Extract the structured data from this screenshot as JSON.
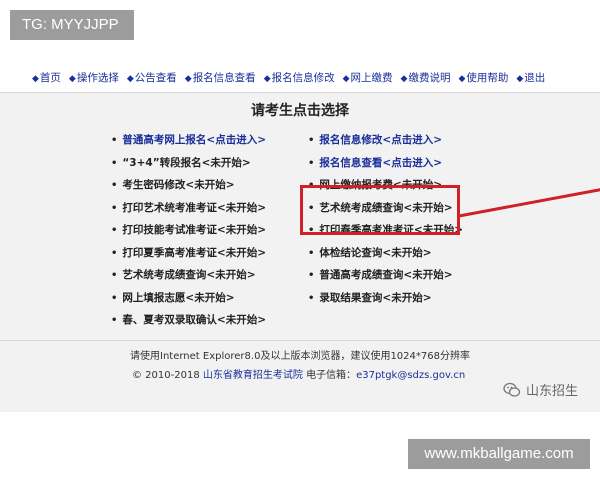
{
  "overlay": {
    "top_tag": "TG: MYYJJPP",
    "bottom_tag": "www.mkballgame.com"
  },
  "nav": {
    "items": [
      {
        "label": "首页"
      },
      {
        "label": "操作选择"
      },
      {
        "label": "公告查看"
      },
      {
        "label": "报名信息查看"
      },
      {
        "label": "报名信息修改"
      },
      {
        "label": "网上缴费"
      },
      {
        "label": "缴费说明"
      },
      {
        "label": "使用帮助"
      },
      {
        "label": "退出"
      }
    ],
    "bullet": "◆"
  },
  "main": {
    "heading": "请考生点击选择",
    "bullet": "•",
    "left_items": [
      {
        "text": "普通高考网上报名<点击进入>",
        "active": true
      },
      {
        "text": "“3+4”转段报名<未开始>",
        "active": false
      },
      {
        "text": "考生密码修改<未开始>",
        "active": false
      },
      {
        "text": "打印艺术统考准考证<未开始>",
        "active": false
      },
      {
        "text": "打印技能考试准考证<未开始>",
        "active": false
      },
      {
        "text": "打印夏季高考准考证<未开始>",
        "active": false
      },
      {
        "text": "艺术统考成绩查询<未开始>",
        "active": false
      },
      {
        "text": "网上填报志愿<未开始>",
        "active": false
      },
      {
        "text": "春、夏考双录取确认<未开始>",
        "active": false
      }
    ],
    "right_items": [
      {
        "text": "报名信息修改<点击进入>",
        "active": true
      },
      {
        "text": "报名信息查看<点击进入>",
        "active": true
      },
      {
        "text": "网上缴纳报考费<未开始>",
        "active": false
      },
      {
        "text": "艺术统考成绩查询<未开始>",
        "active": false
      },
      {
        "text": "打印春季高考准考证<未开始>",
        "active": false
      },
      {
        "text": "体检结论查询<未开始>",
        "active": false
      },
      {
        "text": "普通高考成绩查询<未开始>",
        "active": false
      },
      {
        "text": "录取结果查询<未开始>",
        "active": false
      }
    ]
  },
  "footer": {
    "browser_note": "请使用Internet Explorer8.0及以上版本浏览器，建议使用1024*768分辨率",
    "copyright_prefix": "© 2010-2018",
    "org_link": "山东省教育招生考试院",
    "email_label": "电子信箱：",
    "email": "e37ptgk@sdzs.gov.cn"
  },
  "watermark": {
    "text": "山东招生",
    "icon": "wechat-icon"
  },
  "colors": {
    "link_blue": "#1a2f99",
    "highlight_red": "#d0202a"
  }
}
